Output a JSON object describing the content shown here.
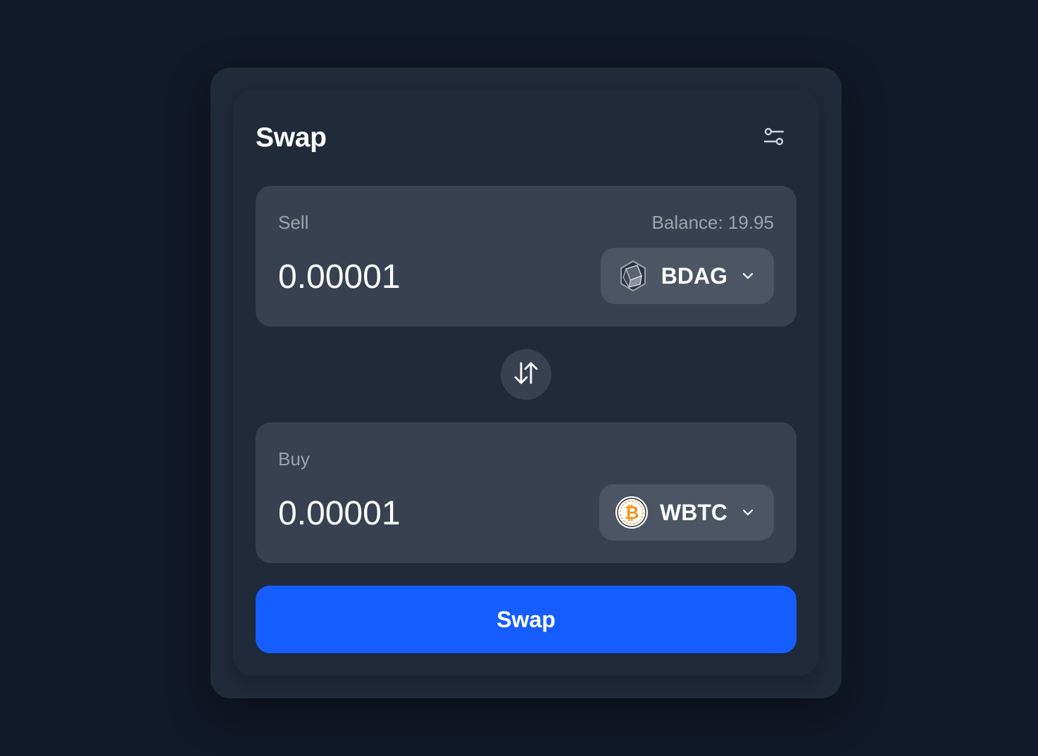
{
  "swap": {
    "title": "Swap",
    "settings_icon": "sliders-icon",
    "sell": {
      "label": "Sell",
      "balance": "Balance: 19.95",
      "amount": "0.00001",
      "token": {
        "symbol": "BDAG",
        "icon": "bdag-cube-icon"
      }
    },
    "flip_icon": "arrows-up-down-icon",
    "buy": {
      "label": "Buy",
      "amount": "0.00001",
      "token": {
        "symbol": "WBTC",
        "icon": "bitcoin-icon"
      }
    },
    "submit_label": "Swap"
  },
  "colors": {
    "background": "#111827",
    "card": "#1f2a3b",
    "panel": "#374151",
    "token_pill": "#4b5563",
    "accent": "#165dff",
    "muted_text": "#9ca3af",
    "bitcoin_orange": "#f7931a"
  }
}
